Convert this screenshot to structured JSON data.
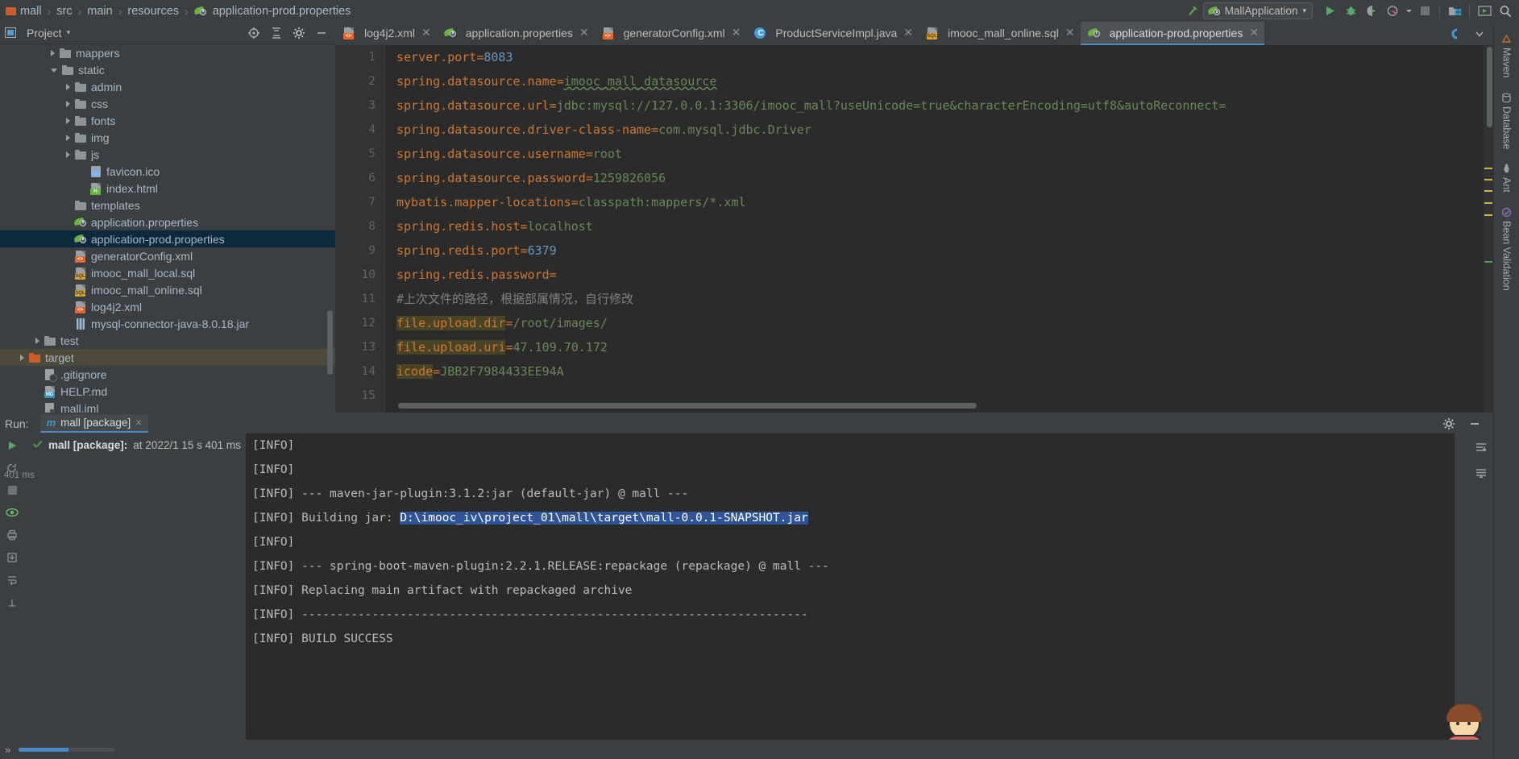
{
  "breadcrumb": {
    "items": [
      "mall",
      "src",
      "main",
      "resources",
      "application-prod.properties"
    ],
    "separator": "›"
  },
  "toolbar": {
    "run_config_name": "MallApplication",
    "caret": "▾",
    "icons": [
      "build-hammer-icon",
      "run-icon",
      "debug-icon",
      "run-coverage-icon",
      "profiler-icon",
      "stop-icon",
      "project-structure-icon",
      "window-icon",
      "search-everywhere-icon"
    ]
  },
  "project_panel": {
    "title": "Project",
    "caret": "▾",
    "header_icons": [
      "locate-icon",
      "collapse-all-icon",
      "settings-gear-icon",
      "hide-icon"
    ],
    "tree": [
      {
        "label": "mappers",
        "indent": 3,
        "arrow": "right",
        "icon": "folder",
        "state": "normal"
      },
      {
        "label": "static",
        "indent": 3,
        "arrow": "down",
        "icon": "folder",
        "state": "normal"
      },
      {
        "label": "admin",
        "indent": 4,
        "arrow": "right",
        "icon": "folder",
        "state": "normal"
      },
      {
        "label": "css",
        "indent": 4,
        "arrow": "right",
        "icon": "folder",
        "state": "normal"
      },
      {
        "label": "fonts",
        "indent": 4,
        "arrow": "right",
        "icon": "folder",
        "state": "normal"
      },
      {
        "label": "img",
        "indent": 4,
        "arrow": "right",
        "icon": "folder",
        "state": "normal"
      },
      {
        "label": "js",
        "indent": 4,
        "arrow": "right",
        "icon": "folder",
        "state": "normal"
      },
      {
        "label": "favicon.ico",
        "indent": 5,
        "arrow": "none",
        "icon": "image",
        "state": "normal"
      },
      {
        "label": "index.html",
        "indent": 5,
        "arrow": "none",
        "icon": "html",
        "state": "normal"
      },
      {
        "label": "templates",
        "indent": 4,
        "arrow": "none",
        "icon": "folder",
        "state": "normal"
      },
      {
        "label": "application.properties",
        "indent": 4,
        "arrow": "none",
        "icon": "spring",
        "state": "normal"
      },
      {
        "label": "application-prod.properties",
        "indent": 4,
        "arrow": "none",
        "icon": "spring",
        "state": "selected"
      },
      {
        "label": "generatorConfig.xml",
        "indent": 4,
        "arrow": "none",
        "icon": "xml",
        "state": "normal"
      },
      {
        "label": "imooc_mall_local.sql",
        "indent": 4,
        "arrow": "none",
        "icon": "sql",
        "state": "normal"
      },
      {
        "label": "imooc_mall_online.sql",
        "indent": 4,
        "arrow": "none",
        "icon": "sql",
        "state": "normal"
      },
      {
        "label": "log4j2.xml",
        "indent": 4,
        "arrow": "none",
        "icon": "xml",
        "state": "normal"
      },
      {
        "label": "mysql-connector-java-8.0.18.jar",
        "indent": 4,
        "arrow": "none",
        "icon": "jar",
        "state": "normal"
      },
      {
        "label": "test",
        "indent": 2,
        "arrow": "right",
        "icon": "folder",
        "state": "normal"
      },
      {
        "label": "target",
        "indent": 1,
        "arrow": "right",
        "icon": "folder-orange",
        "state": "target"
      },
      {
        "label": ".gitignore",
        "indent": 2,
        "arrow": "none",
        "icon": "gitignore",
        "state": "normal"
      },
      {
        "label": "HELP.md",
        "indent": 2,
        "arrow": "none",
        "icon": "md",
        "state": "normal"
      },
      {
        "label": "mall.iml",
        "indent": 2,
        "arrow": "none",
        "icon": "iml",
        "state": "normal"
      }
    ]
  },
  "editor": {
    "tabs": [
      {
        "label": "log4j2.xml",
        "icon": "xml",
        "active": false,
        "closable": true
      },
      {
        "label": "application.properties",
        "icon": "spring",
        "active": false,
        "closable": true
      },
      {
        "label": "generatorConfig.xml",
        "icon": "xml",
        "active": false,
        "closable": true
      },
      {
        "label": "ProductServiceImpl.java",
        "icon": "class",
        "active": false,
        "closable": true
      },
      {
        "label": "imooc_mall_online.sql",
        "icon": "sql",
        "active": false,
        "closable": true
      },
      {
        "label": "application-prod.properties",
        "icon": "spring",
        "active": true,
        "closable": true
      }
    ],
    "line_numbers": [
      "1",
      "2",
      "3",
      "4",
      "5",
      "6",
      "7",
      "8",
      "9",
      "10",
      "11",
      "12",
      "13",
      "14",
      "15"
    ],
    "lines": [
      {
        "n": 1,
        "key": "server.port",
        "eq": "=",
        "value": "8083",
        "vtype": "num"
      },
      {
        "n": 2,
        "key": "spring.datasource.name",
        "eq": "=",
        "value": "imooc_mall_datasource",
        "vtype": "wavy"
      },
      {
        "n": 3,
        "key": "spring.datasource.url",
        "eq": "=",
        "value": "jdbc:mysql://127.0.0.1:3306/imooc_mall?useUnicode=true&characterEncoding=utf8&autoReconnect=",
        "vtype": "val"
      },
      {
        "n": 4,
        "key": "spring.datasource.driver-class-name",
        "eq": "=",
        "value": "com.mysql.jdbc.Driver",
        "vtype": "val"
      },
      {
        "n": 5,
        "key": "spring.datasource.username",
        "eq": "=",
        "value": "root",
        "vtype": "val"
      },
      {
        "n": 6,
        "key": "spring.datasource.password",
        "eq": "=",
        "value": "1259826056",
        "vtype": "val"
      },
      {
        "n": 7,
        "key": "mybatis.mapper-locations",
        "eq": "=",
        "value": "classpath:mappers/*.xml",
        "vtype": "val"
      },
      {
        "n": 8,
        "key": "spring.redis.host",
        "eq": "=",
        "value": "localhost",
        "vtype": "val"
      },
      {
        "n": 9,
        "key": "spring.redis.port",
        "eq": "=",
        "value": "6379",
        "vtype": "num"
      },
      {
        "n": 10,
        "key": "spring.redis.password",
        "eq": "=",
        "value": "",
        "vtype": "val"
      },
      {
        "n": 11,
        "comment": "#上次文件的路径，根据部属情况，自行修改"
      },
      {
        "n": 12,
        "key": "file.upload.dir",
        "eq": "=",
        "value": "/root/images/",
        "vtype": "val",
        "key_highlight": true
      },
      {
        "n": 13,
        "key": "file.upload.uri",
        "eq": "=",
        "value": "47.109.70.172",
        "vtype": "val",
        "key_highlight": true
      },
      {
        "n": 14,
        "key": "icode",
        "eq": "=",
        "value": "JBB2F7984433EE94A",
        "vtype": "val",
        "key_highlight": true
      },
      {
        "n": 15,
        "blank": true
      }
    ]
  },
  "right_toolwindows": [
    {
      "label": "Maven",
      "icon": "maven-icon"
    },
    {
      "label": "Database",
      "icon": "database-icon"
    },
    {
      "label": "Ant",
      "icon": "ant-icon"
    },
    {
      "label": "Bean Validation",
      "icon": "bean-validation-icon"
    }
  ],
  "run_panel": {
    "label": "Run:",
    "tab_label": "mall [package]",
    "tab_icon": "maven-m-icon",
    "tab_close": "×",
    "status_prefix": "mall [package]:",
    "status_text": "at 2022/1 15 s 401 ms",
    "timing": "401 ms",
    "header_icons": [
      "settings-gear-icon",
      "minimize-icon"
    ],
    "left_icons": [
      "rerun-icon",
      "rerun-failed-icon",
      "stop-icon",
      "show-passed-icon",
      "print-icon",
      "export-icon",
      "soft-wrap-icon",
      "help-icon"
    ],
    "right_icons": [
      "scroll-to-end-icon",
      "scroll-down-icon"
    ],
    "console_lines": [
      {
        "text": "[INFO]"
      },
      {
        "text": "[INFO]"
      },
      {
        "text": "[INFO] --- maven-jar-plugin:3.1.2:jar (default-jar) @ mall ---"
      },
      {
        "prefix": "[INFO] Building jar: ",
        "selected": "D:\\imooc_iv\\project_01\\mall\\target\\mall-0.0.1-SNAPSHOT.jar"
      },
      {
        "text": "[INFO]"
      },
      {
        "text": "[INFO] --- spring-boot-maven-plugin:2.2.1.RELEASE:repackage (repackage) @ mall ---"
      },
      {
        "text": "[INFO] Replacing main artifact with repackaged archive"
      },
      {
        "text": "[INFO] ------------------------------------------------------------------------"
      },
      {
        "text": "[INFO] BUILD SUCCESS"
      }
    ]
  },
  "colors": {
    "accent_blue": "#4a88c7",
    "selection_blue": "#2f5597",
    "tree_selection": "#0d293e",
    "spring_green": "#6db33f",
    "editor_bg": "#2b2b2b",
    "panel_bg": "#3c3f41",
    "key_orange": "#cc7832",
    "value_green": "#6a8759",
    "number_blue": "#6897bb",
    "target_highlight": "#4e4a3b"
  }
}
